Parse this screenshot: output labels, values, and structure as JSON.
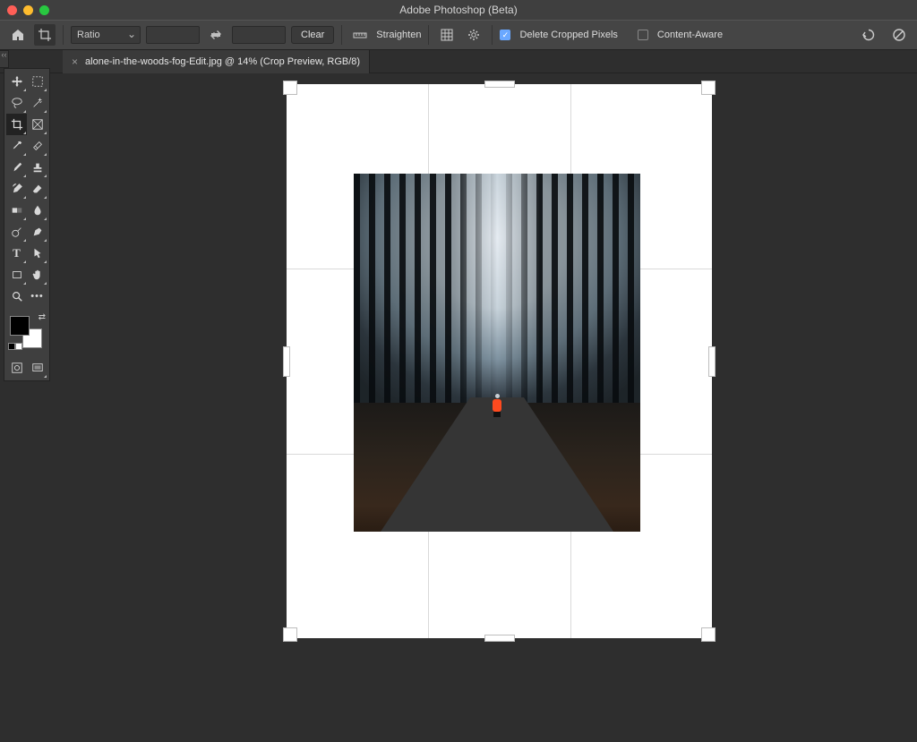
{
  "app": {
    "title": "Adobe Photoshop (Beta)"
  },
  "tab": {
    "label": "alone-in-the-woods-fog-Edit.jpg @ 14% (Crop Preview, RGB/8)"
  },
  "options": {
    "ratio_label": "Ratio",
    "width": "",
    "height": "",
    "clear": "Clear",
    "straighten": "Straighten",
    "delete_cropped": "Delete Cropped Pixels",
    "content_aware": "Content-Aware",
    "delete_checked": true,
    "content_aware_checked": false
  },
  "tools": {
    "home": "home-icon",
    "crop_tool": "crop-icon",
    "move": "move",
    "marquee": "marquee",
    "lasso": "lasso",
    "wand": "wand",
    "crop": "crop",
    "frame": "frame",
    "eyedrop": "eyedrop",
    "patch": "patch",
    "brush": "brush",
    "stamp": "stamp",
    "history": "history",
    "eraser": "eraser",
    "gradient": "gradient",
    "blur": "blur",
    "dodge": "dodge",
    "pen": "pen",
    "type": "type",
    "path": "path",
    "rect": "rect",
    "hand": "hand",
    "zoom": "zoom",
    "more": "more"
  }
}
